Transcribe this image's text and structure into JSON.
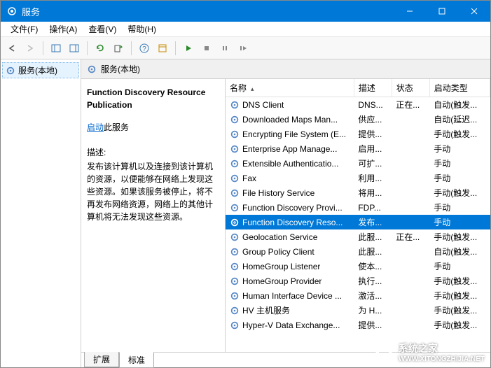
{
  "window": {
    "title": "服务"
  },
  "menu": {
    "file": "文件(F)",
    "action": "操作(A)",
    "view": "查看(V)",
    "help": "帮助(H)"
  },
  "tree": {
    "root": "服务(本地)"
  },
  "panel": {
    "header": "服务(本地)",
    "selected_title": "Function Discovery Resource Publication",
    "start_link": "启动",
    "start_suffix": "此服务",
    "desc_label": "描述:",
    "desc_text": "发布该计算机以及连接到该计算机的资源，以便能够在网络上发现这些资源。如果该服务被停止，将不再发布网络资源，网络上的其他计算机将无法发现这些资源。"
  },
  "columns": {
    "name": "名称",
    "desc": "描述",
    "status": "状态",
    "startup": "启动类型"
  },
  "services": [
    {
      "name": "DNS Client",
      "desc": "DNS...",
      "status": "正在...",
      "startup": "自动(触发..."
    },
    {
      "name": "Downloaded Maps Man...",
      "desc": "供应...",
      "status": "",
      "startup": "自动(延迟..."
    },
    {
      "name": "Encrypting File System (E...",
      "desc": "提供...",
      "status": "",
      "startup": "手动(触发..."
    },
    {
      "name": "Enterprise App Manage...",
      "desc": "启用...",
      "status": "",
      "startup": "手动"
    },
    {
      "name": "Extensible Authenticatio...",
      "desc": "可扩...",
      "status": "",
      "startup": "手动"
    },
    {
      "name": "Fax",
      "desc": "利用...",
      "status": "",
      "startup": "手动"
    },
    {
      "name": "File History Service",
      "desc": "将用...",
      "status": "",
      "startup": "手动(触发..."
    },
    {
      "name": "Function Discovery Provi...",
      "desc": "FDP...",
      "status": "",
      "startup": "手动"
    },
    {
      "name": "Function Discovery Reso...",
      "desc": "发布...",
      "status": "",
      "startup": "手动",
      "selected": true
    },
    {
      "name": "Geolocation Service",
      "desc": "此服...",
      "status": "正在...",
      "startup": "手动(触发..."
    },
    {
      "name": "Group Policy Client",
      "desc": "此服...",
      "status": "",
      "startup": "自动(触发..."
    },
    {
      "name": "HomeGroup Listener",
      "desc": "使本...",
      "status": "",
      "startup": "手动"
    },
    {
      "name": "HomeGroup Provider",
      "desc": "执行...",
      "status": "",
      "startup": "手动(触发..."
    },
    {
      "name": "Human Interface Device ...",
      "desc": "激活...",
      "status": "",
      "startup": "手动(触发..."
    },
    {
      "name": "HV 主机服务",
      "desc": "为 H...",
      "status": "",
      "startup": "手动(触发..."
    },
    {
      "name": "Hyper-V Data Exchange...",
      "desc": "提供...",
      "status": "",
      "startup": "手动(触发..."
    }
  ],
  "tabs": {
    "extended": "扩展",
    "standard": "标准"
  },
  "watermark": {
    "name": "系统之家",
    "url": "WWW.XITONGZHIJIA.NET"
  }
}
